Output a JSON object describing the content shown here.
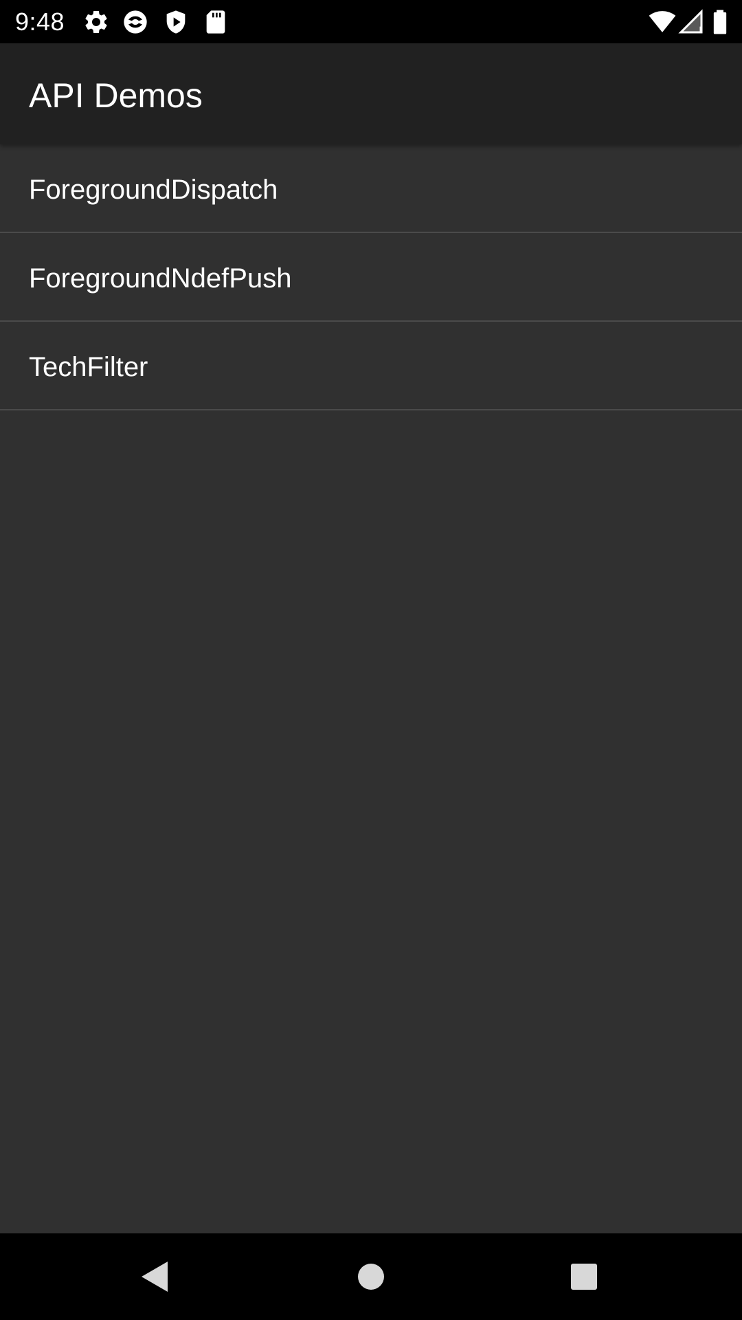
{
  "status_bar": {
    "time": "9:48",
    "icons_left": [
      "settings-icon",
      "app-circle-icon",
      "shield-play-icon",
      "sd-card-icon"
    ],
    "icons_right": [
      "wifi-icon",
      "cell-signal-icon",
      "battery-icon"
    ]
  },
  "app_bar": {
    "title": "API Demos",
    "background": "#212121"
  },
  "list": {
    "background": "#303030",
    "divider_color": "#4a4a4a",
    "items": [
      {
        "label": "ForegroundDispatch"
      },
      {
        "label": "ForegroundNdefPush"
      },
      {
        "label": "TechFilter"
      }
    ]
  },
  "nav_bar": {
    "buttons": [
      "back-icon",
      "home-icon",
      "recents-icon"
    ]
  }
}
